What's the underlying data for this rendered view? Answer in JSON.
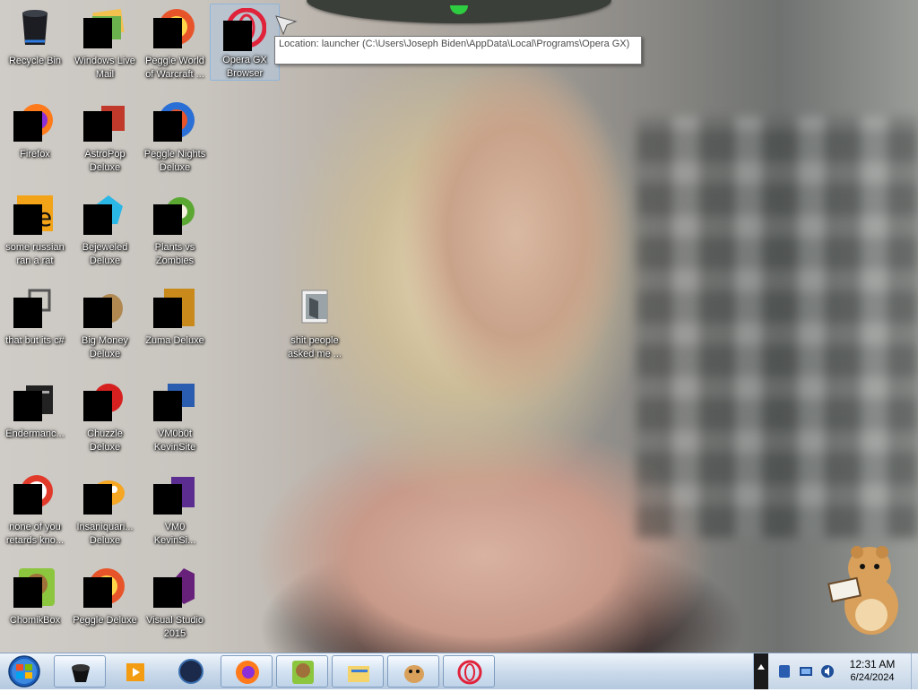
{
  "desktop": {
    "icons": [
      {
        "label": "Recycle Bin",
        "icon": "recycle-bin-icon"
      },
      {
        "label": "Windows Live\nMail",
        "icon": "mail-icon"
      },
      {
        "label": "Peggle World\nof Warcraft ...",
        "icon": "peggle-icon"
      },
      {
        "label": "Opera GX\nBrowser",
        "icon": "opera-icon"
      },
      {
        "label": "Firefox",
        "icon": "firefox-icon"
      },
      {
        "label": "AstroPop\nDeluxe",
        "icon": "astropop-icon"
      },
      {
        "label": "Peggle Nights\nDeluxe",
        "icon": "peggle-nights-icon"
      },
      {
        "label": "some russian\nran a rat",
        "icon": "app-icon"
      },
      {
        "label": "Bejeweled\nDeluxe",
        "icon": "bejeweled-icon"
      },
      {
        "label": "Plants vs\nZombies",
        "icon": "plants-vs-zombies-icon"
      },
      {
        "label": "that but its c#",
        "icon": "shortcut-icon"
      },
      {
        "label": "Big Money\nDeluxe",
        "icon": "big-money-icon"
      },
      {
        "label": "Zuma Deluxe",
        "icon": "zuma-icon"
      },
      {
        "label": "shit people\nasked me ...",
        "icon": "folder-icon"
      },
      {
        "label": "Endermanc...",
        "icon": "window-icon"
      },
      {
        "label": "Chuzzle\nDeluxe",
        "icon": "chuzzle-icon"
      },
      {
        "label": "VM0b0t\nKevinSite",
        "icon": "vm-icon"
      },
      {
        "label": "none of you\nretards kno...",
        "icon": "app-icon"
      },
      {
        "label": "Insaniquari...\nDeluxe",
        "icon": "insaniquarium-icon"
      },
      {
        "label": "VM0\nKevinSi...",
        "icon": "vm-icon"
      },
      {
        "label": "ChomikBox",
        "icon": "chomikbox-icon"
      },
      {
        "label": "Peggle Deluxe",
        "icon": "peggle-icon"
      },
      {
        "label": "Visual Studio\n2015",
        "icon": "visual-studio-icon"
      }
    ],
    "selected": "Opera GX Browser"
  },
  "tooltip": {
    "text": "Location: launcher (C:\\Users\\Joseph Biden\\AppData\\Local\\Programs\\Opera GX)"
  },
  "taskbar": {
    "start": "windows-start-icon",
    "buttons": [
      {
        "icon": "recycle-bin-icon",
        "pinned": false
      },
      {
        "icon": "media-player-icon",
        "pinned": true
      },
      {
        "icon": "globe-icon",
        "pinned": true
      },
      {
        "icon": "firefox-icon",
        "pinned": false
      },
      {
        "icon": "chomikbox-icon",
        "pinned": false
      },
      {
        "icon": "explorer-icon",
        "pinned": false
      },
      {
        "icon": "hamster-icon",
        "pinned": false
      },
      {
        "icon": "opera-icon",
        "pinned": false
      }
    ]
  },
  "tray": {
    "time": "12:31 AM",
    "date": "6/24/2024",
    "icons": [
      "bluetooth-icon",
      "network-icon",
      "volume-icon"
    ]
  },
  "colors": {
    "taskbar": "#c9d9ea",
    "tooltip_border": "#767676",
    "label_text": "#ffffff"
  }
}
